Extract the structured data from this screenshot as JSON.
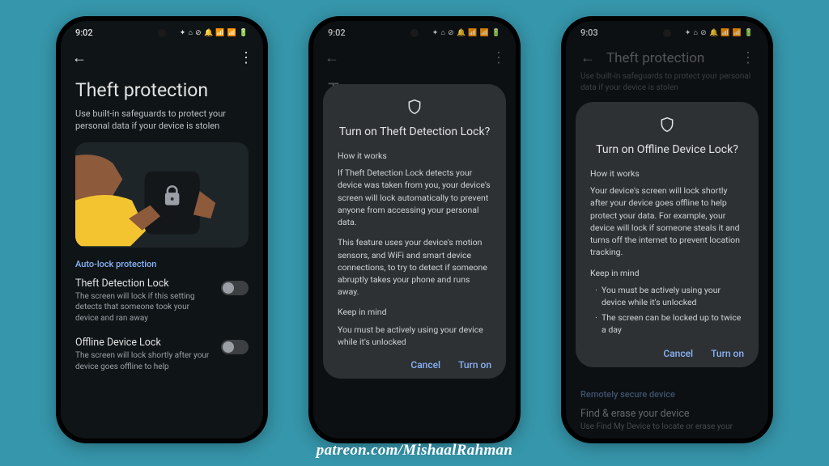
{
  "status_time": "9:02",
  "status_time_alt": "9:03",
  "page": {
    "title": "Theft protection",
    "subtitle": "Use built-in safeguards to protect your personal data if your device is stolen",
    "section_autolock": "Auto-lock protection",
    "section_remote": "Remotely secure device",
    "setting1_title": "Theft Detection Lock",
    "setting1_desc": "The screen will lock if this setting detects that someone took your device and ran away",
    "setting2_title": "Offline Device Lock",
    "setting2_desc": "The screen will lock shortly after your device goes offline to help",
    "setting3_title": "Find & erase your device",
    "setting3_desc": "Use Find My Device to locate or erase your"
  },
  "dialog1": {
    "title": "Turn on Theft Detection Lock?",
    "how_head": "How it works",
    "p1": "If Theft Detection Lock detects your device was taken from you, your device's screen will lock automatically to prevent anyone from accessing your personal data.",
    "p2": "This feature uses your device's motion sensors, and WiFi and smart device connections, to try to detect if someone abruptly takes your phone and runs away.",
    "keep_head": "Keep in mind",
    "p3": "You must be actively using your device while it's unlocked",
    "cancel": "Cancel",
    "confirm": "Turn on"
  },
  "dialog2": {
    "title": "Turn on Offline Device Lock?",
    "how_head": "How it works",
    "p1": "Your device's screen will lock shortly after your device goes offline to help protect your data. For example, your device will lock if someone steals it and turns off the internet to prevent location tracking.",
    "keep_head": "Keep in mind",
    "b1": "You must be actively using your device while it's unlocked",
    "b2": "The screen can be locked up to twice a day",
    "cancel": "Cancel",
    "confirm": "Turn on"
  },
  "credit": "patreon.com/MishaalRahman"
}
